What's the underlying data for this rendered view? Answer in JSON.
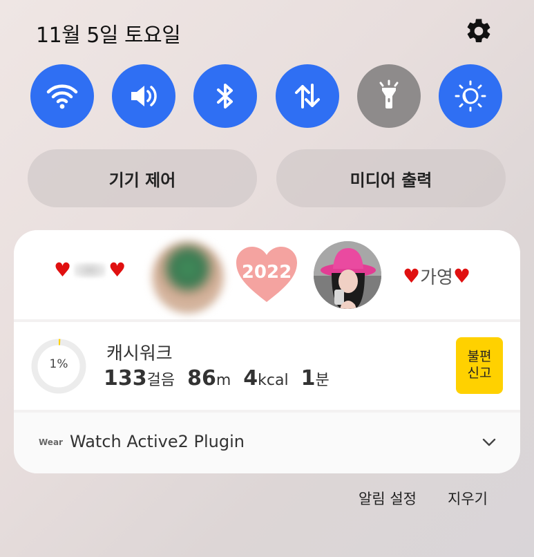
{
  "header": {
    "date": "11월 5일 토요일"
  },
  "quick_settings": [
    {
      "icon": "wifi-icon",
      "active": true
    },
    {
      "icon": "sound-icon",
      "active": true
    },
    {
      "icon": "bluetooth-icon",
      "active": true
    },
    {
      "icon": "mobile-data-icon",
      "active": true
    },
    {
      "icon": "flashlight-icon",
      "active": false
    },
    {
      "icon": "eye-comfort-icon",
      "active": true
    }
  ],
  "pills": {
    "device_control": "기기 제어",
    "media_output": "미디어 출력"
  },
  "widget": {
    "right_name": "가영",
    "year": "2022"
  },
  "cashwalk": {
    "app_name": "캐시워크",
    "progress_percent": 1,
    "progress_label": "1%",
    "steps": "133",
    "steps_unit": "걸음",
    "distance": "86",
    "distance_unit": "m",
    "calories": "4",
    "calories_unit": "kcal",
    "minutes": "1",
    "minutes_unit": "분",
    "report_label": "불편\n신고"
  },
  "plugin": {
    "logo": "Wear",
    "title": "Watch Active2 Plugin"
  },
  "footer": {
    "notification_settings": "알림 설정",
    "clear": "지우기"
  },
  "colors": {
    "accent": "#2f6ff3",
    "inactive": "#8e8b8b",
    "heart_pink": "#f3a0a0",
    "report_yellow": "#ffd100"
  }
}
